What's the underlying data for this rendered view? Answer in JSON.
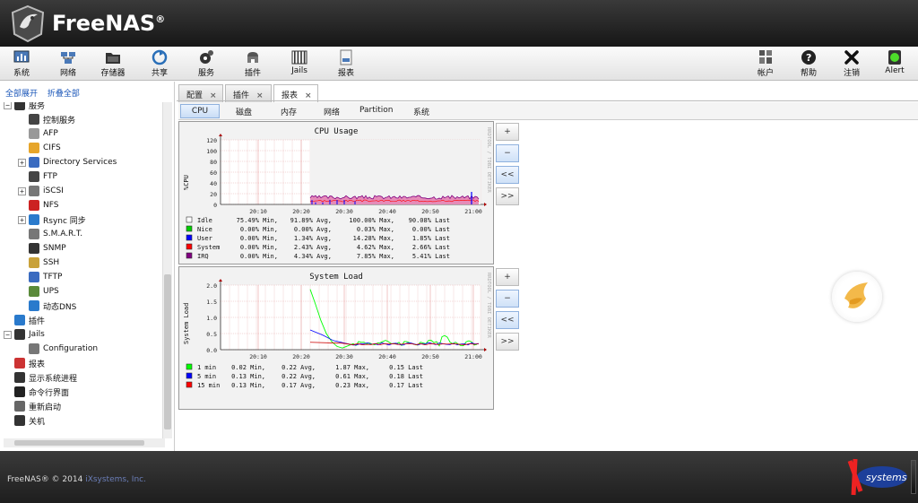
{
  "header": {
    "brand": "FreeNAS",
    "reg": "®"
  },
  "toolbar": {
    "left": [
      {
        "label": "系统",
        "icon": "system-icon"
      },
      {
        "label": "网络",
        "icon": "network-icon"
      },
      {
        "label": "存储器",
        "icon": "storage-icon"
      },
      {
        "label": "共享",
        "icon": "sharing-icon"
      },
      {
        "label": "服务",
        "icon": "services-icon"
      },
      {
        "label": "插件",
        "icon": "plugins-icon"
      },
      {
        "label": "Jails",
        "icon": "jails-icon"
      },
      {
        "label": "报表",
        "icon": "reporting-icon"
      }
    ],
    "right": [
      {
        "label": "帐户",
        "icon": "account-icon"
      },
      {
        "label": "帮助",
        "icon": "help-icon"
      },
      {
        "label": "注销",
        "icon": "logout-icon"
      },
      {
        "label": "Alert",
        "icon": "alert-icon"
      }
    ]
  },
  "sidebar": {
    "expand_all": "全部展开",
    "collapse_all": "折叠全部",
    "tree": [
      {
        "label": "服务",
        "icon": "services-icon",
        "toggle": "−"
      },
      {
        "label": "控制服务",
        "icon": "control-services-icon"
      },
      {
        "label": "AFP",
        "icon": "afp-icon"
      },
      {
        "label": "CIFS",
        "icon": "cifs-icon"
      },
      {
        "label": "Directory Services",
        "icon": "directory-services-icon",
        "toggle": "+"
      },
      {
        "label": "FTP",
        "icon": "ftp-icon"
      },
      {
        "label": "iSCSI",
        "icon": "iscsi-icon",
        "toggle": "+"
      },
      {
        "label": "NFS",
        "icon": "nfs-icon"
      },
      {
        "label": "Rsync 同步",
        "icon": "rsync-icon",
        "toggle": "+"
      },
      {
        "label": "S.M.A.R.T.",
        "icon": "smart-icon"
      },
      {
        "label": "SNMP",
        "icon": "snmp-icon"
      },
      {
        "label": "SSH",
        "icon": "ssh-icon"
      },
      {
        "label": "TFTP",
        "icon": "tftp-icon"
      },
      {
        "label": "UPS",
        "icon": "ups-icon"
      },
      {
        "label": "动态DNS",
        "icon": "dynamic-dns-icon"
      },
      {
        "label": "插件",
        "icon": "plugins-icon"
      },
      {
        "label": "Jails",
        "icon": "jails-icon",
        "toggle": "−"
      },
      {
        "label": "Configuration",
        "icon": "wrench-icon"
      },
      {
        "label": "报表",
        "icon": "reporting-icon"
      },
      {
        "label": "显示系统进程",
        "icon": "processes-icon"
      },
      {
        "label": "命令行界面",
        "icon": "shell-icon"
      },
      {
        "label": "重新启动",
        "icon": "reboot-icon"
      },
      {
        "label": "关机",
        "icon": "shutdown-icon"
      }
    ]
  },
  "tabs": [
    {
      "label": "配置"
    },
    {
      "label": "插件"
    },
    {
      "label": "报表",
      "active": true
    }
  ],
  "tab_close": "×",
  "subtabs": [
    {
      "label": "CPU",
      "active": true
    },
    {
      "label": "磁盘"
    },
    {
      "label": "内存"
    },
    {
      "label": "网络"
    },
    {
      "label": "Partition"
    },
    {
      "label": "系统"
    }
  ],
  "graph_buttons": {
    "zoom_in": "+",
    "zoom_out": "−",
    "back": "<<",
    "forward": ">>"
  },
  "side_label": "RRDTOOL / TOBI OETIKER",
  "charts": [
    {
      "title": "CPU Usage",
      "ylabel": "%CPU",
      "yticks": [
        "120",
        "100",
        "80",
        "60",
        "40",
        "20",
        "0"
      ],
      "xticks": [
        "20:10",
        "20:20",
        "20:30",
        "20:40",
        "20:50",
        "21:00"
      ],
      "legend": [
        {
          "name": "Idle",
          "color": "#ffffff",
          "min": "75.49% Min,",
          "avg": "91.89% Avg,",
          "max": "100.00% Max,",
          "last": "90.08% Last"
        },
        {
          "name": "Nice",
          "color": "#00cc00",
          "min": "0.00% Min,",
          "avg": "0.00% Avg,",
          "max": "0.03% Max,",
          "last": "0.00% Last"
        },
        {
          "name": "User",
          "color": "#0000ff",
          "min": "0.00% Min,",
          "avg": "1.34% Avg,",
          "max": "14.28% Max,",
          "last": "1.85% Last"
        },
        {
          "name": "System",
          "color": "#ff0000",
          "min": "0.00% Min,",
          "avg": "2.43% Avg,",
          "max": "4.62% Max,",
          "last": "2.66% Last"
        },
        {
          "name": "IRQ",
          "color": "#800080",
          "min": "0.00% Min,",
          "avg": "4.34% Avg,",
          "max": "7.85% Max,",
          "last": "5.41% Last"
        }
      ]
    },
    {
      "title": "System Load",
      "ylabel": "System Load",
      "yticks": [
        "2.0",
        "1.5",
        "1.0",
        "0.5",
        "0.0"
      ],
      "xticks": [
        "20:10",
        "20:20",
        "20:30",
        "20:40",
        "20:50",
        "21:00"
      ],
      "legend": [
        {
          "name": "1 min",
          "color": "#00ff00",
          "min": "0.02 Min,",
          "avg": "0.22 Avg,",
          "max": "1.87 Max,",
          "last": "0.15 Last"
        },
        {
          "name": "5 min",
          "color": "#0000ff",
          "min": "0.13 Min,",
          "avg": "0.22 Avg,",
          "max": "0.61 Max,",
          "last": "0.18 Last"
        },
        {
          "name": "15 min",
          "color": "#ff0000",
          "min": "0.13 Min,",
          "avg": "0.17 Avg,",
          "max": "0.23 Max,",
          "last": "0.17 Last"
        }
      ]
    }
  ],
  "footer": {
    "copyright": "FreeNAS® © 2014 ",
    "company": "iXsystems, Inc.",
    "logo": "systems"
  }
}
